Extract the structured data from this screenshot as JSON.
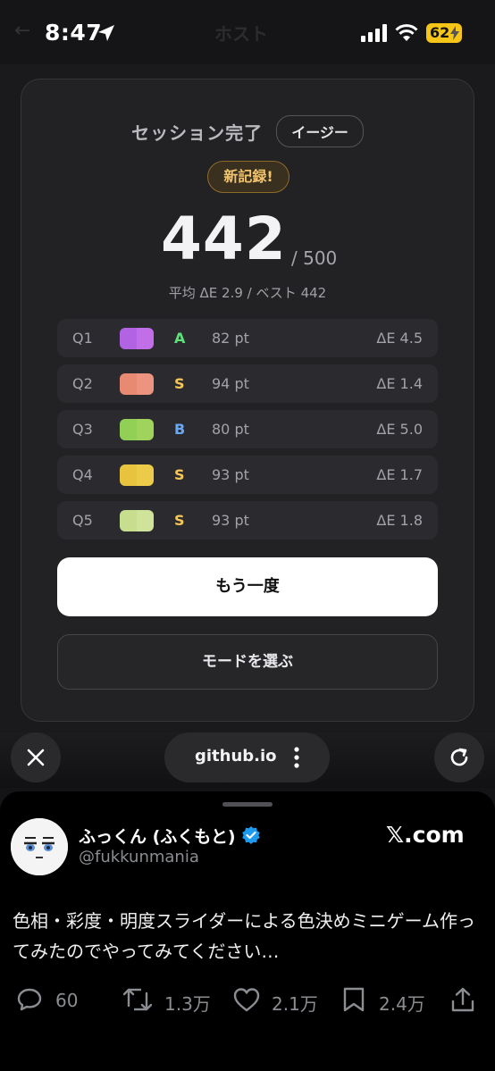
{
  "status_bar": {
    "time": "8:47",
    "battery": "62"
  },
  "background_page": {
    "back_glyph": "←",
    "title": "ホスト"
  },
  "result_card": {
    "title": "セッション完了",
    "mode": "イージー",
    "badge": "新記録!",
    "score": "442",
    "score_max": "/ 500",
    "stats": "平均 ΔE 2.9 / ベスト 442",
    "rounds": [
      {
        "q": "Q1",
        "target_color": "#b263e3",
        "guess_color": "#c16ee8",
        "grade": "A",
        "grade_color": "#5ee07a",
        "points": "82 pt",
        "delta_e": "ΔE 4.5"
      },
      {
        "q": "Q2",
        "target_color": "#e88a72",
        "guess_color": "#ed9480",
        "grade": "S",
        "grade_color": "#f5c75a",
        "points": "94 pt",
        "delta_e": "ΔE 1.4"
      },
      {
        "q": "Q3",
        "target_color": "#92cf56",
        "guess_color": "#9fd35c",
        "grade": "B",
        "grade_color": "#6aa8f2",
        "points": "80 pt",
        "delta_e": "ΔE 5.0"
      },
      {
        "q": "Q4",
        "target_color": "#e8c33e",
        "guess_color": "#eccb4a",
        "grade": "S",
        "grade_color": "#f5c75a",
        "points": "93 pt",
        "delta_e": "ΔE 1.7"
      },
      {
        "q": "Q5",
        "target_color": "#c7de8e",
        "guess_color": "#d0e39a",
        "grade": "S",
        "grade_color": "#f5c75a",
        "points": "93 pt",
        "delta_e": "ΔE 1.8"
      }
    ],
    "retry_label": "もう一度",
    "choose_mode_label": "モードを選ぶ"
  },
  "browser": {
    "url": "github.io"
  },
  "post": {
    "author": "ふっくん (ふくもと)",
    "handle": "@fukkunmania",
    "site": "𝕏.com",
    "text": "色相・彩度・明度スライダーによる色決めミニゲーム作ってみたのでやってみてください…",
    "replies": "60",
    "reposts": "1.3万",
    "likes": "2.1万",
    "bookmarks": "2.4万"
  },
  "colors": {
    "accent_verified": "#1d9bf0",
    "battery": "#f5c518",
    "badge_gold": "#f2c46b"
  }
}
